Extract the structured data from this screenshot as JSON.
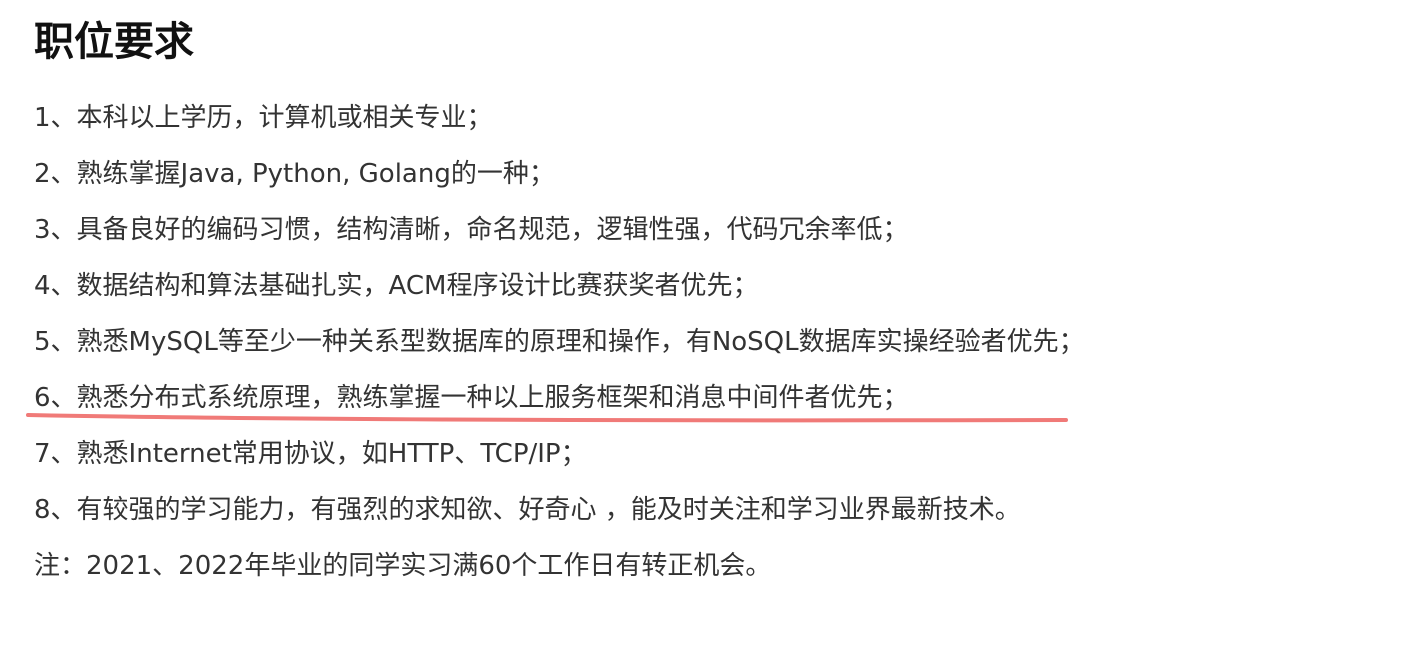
{
  "section": {
    "title": "职位要求"
  },
  "requirements": [
    "1、本科以上学历，计算机或相关专业；",
    "2、熟练掌握Java, Python, Golang的一种；",
    "3、具备良好的编码习惯，结构清晰，命名规范，逻辑性强，代码冗余率低；",
    "4、数据结构和算法基础扎实，ACM程序设计比赛获奖者优先；",
    "5、熟悉MySQL等至少一种关系型数据库的原理和操作，有NoSQL数据库实操经验者优先；",
    "6、熟悉分布式系统原理，熟练掌握一种以上服务框架和消息中间件者优先；",
    "7、熟悉Internet常用协议，如HTTP、TCP/IP；",
    "8、有较强的学习能力，有强烈的求知欲、好奇心 ，能及时关注和学习业界最新技术。",
    "注：2021、2022年毕业的同学实习满60个工作日有转正机会。"
  ],
  "annotation": {
    "underline_color": "#f07a78"
  }
}
